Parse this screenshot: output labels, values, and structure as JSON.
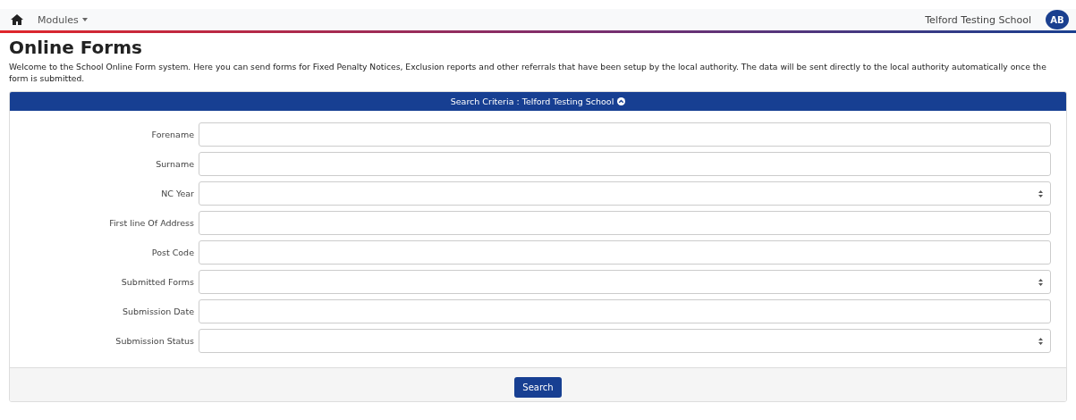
{
  "nav": {
    "menu": "Modules",
    "school": "Telford Testing School",
    "avatar": "AB"
  },
  "title": "Online Forms",
  "intro": "Welcome to the School Online Form system. Here you can send forms for Fixed Penalty Notices, Exclusion reports and other referrals that have been setup by the local authority. The data will be sent directly to the local authority automatically once the form is submitted.",
  "panel": {
    "title": "Search Criteria : Telford Testing School",
    "expanded": true
  },
  "fields": [
    {
      "label": "Forename",
      "kind": "text"
    },
    {
      "label": "Surname",
      "kind": "text"
    },
    {
      "label": "NC Year",
      "kind": "select"
    },
    {
      "label": "First line Of Address",
      "kind": "text"
    },
    {
      "label": "Post Code",
      "kind": "text"
    },
    {
      "label": "Submitted Forms",
      "kind": "select"
    },
    {
      "label": "Submission Date",
      "kind": "text"
    },
    {
      "label": "Submission Status",
      "kind": "select"
    }
  ],
  "button": "Search"
}
